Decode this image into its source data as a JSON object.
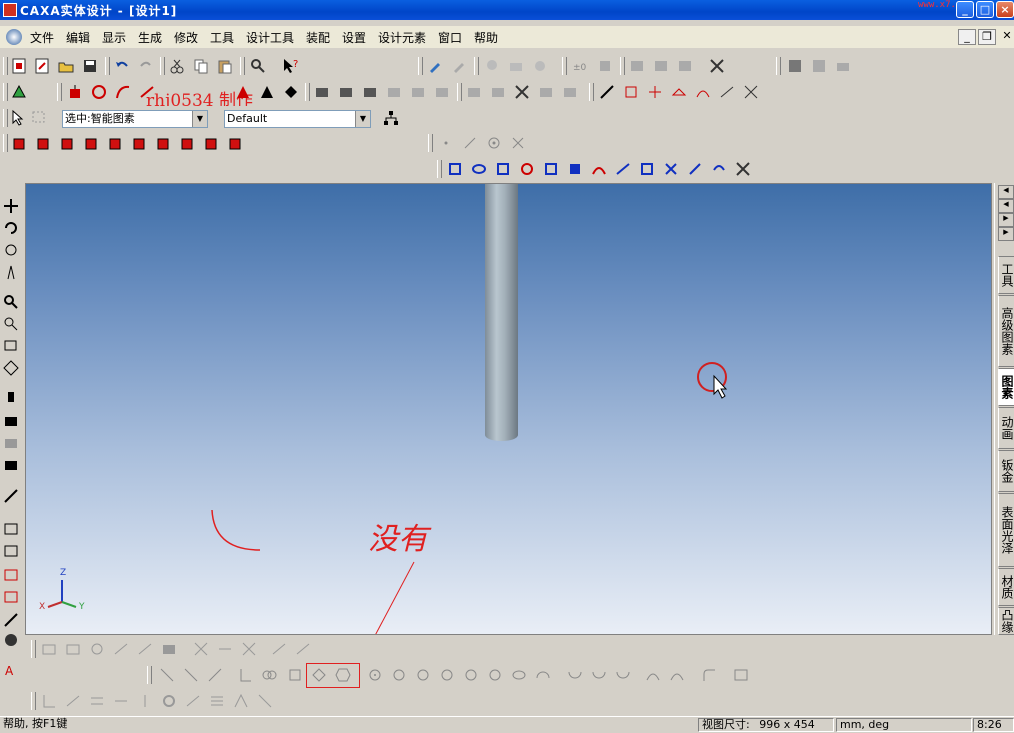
{
  "window": {
    "title": "CAXA实体设计 - [设计1]",
    "watermark": "www.x7.cn",
    "accent": "#0a4fd8"
  },
  "menu": [
    "文件",
    "编辑",
    "显示",
    "生成",
    "修改",
    "工具",
    "设计工具",
    "装配",
    "设置",
    "设计元素",
    "窗口",
    "帮助"
  ],
  "selection": {
    "filter_value": "选中:智能图素",
    "style_value": "Default"
  },
  "annotation": {
    "author": "rhj0534 制作",
    "handwriting": "没有",
    "color": "#e02020"
  },
  "right_tabs": [
    "工具",
    "高级图素",
    "图素",
    "动画",
    "钣金",
    "表面光泽",
    "材质",
    "凸缘"
  ],
  "right_tabs_active": 2,
  "axes": {
    "x": "X",
    "y": "Y",
    "z": "Z"
  },
  "status": {
    "help": "帮助, 按F1键",
    "view_size_label": "视图尺寸:",
    "view_size_value": "996 x 454",
    "units": "mm, deg",
    "time": "8:26"
  }
}
